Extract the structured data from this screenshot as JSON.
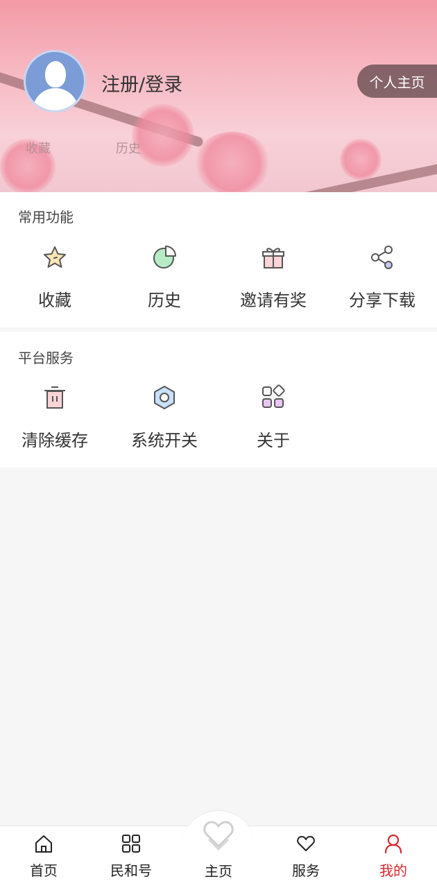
{
  "profile": {
    "login_text": "注册/登录",
    "home_button": "个人主页",
    "stats": [
      {
        "label": "收藏"
      },
      {
        "label": "历史"
      }
    ]
  },
  "common": {
    "title": "常用功能",
    "items": [
      {
        "label": "收藏",
        "icon": "star-icon"
      },
      {
        "label": "历史",
        "icon": "pie-chart-icon"
      },
      {
        "label": "邀请有奖",
        "icon": "gift-icon"
      },
      {
        "label": "分享下载",
        "icon": "share-icon"
      }
    ]
  },
  "platform": {
    "title": "平台服务",
    "items": [
      {
        "label": "清除缓存",
        "icon": "trash-icon"
      },
      {
        "label": "系统开关",
        "icon": "settings-hexagon-icon"
      },
      {
        "label": "关于",
        "icon": "apps-icon"
      }
    ]
  },
  "tabbar": {
    "items": [
      {
        "label": "首页",
        "icon": "home-icon"
      },
      {
        "label": "民和号",
        "icon": "grid-icon"
      },
      {
        "label": "主页",
        "icon": "heart-outline-icon"
      },
      {
        "label": "服务",
        "icon": "heart-icon"
      },
      {
        "label": "我的",
        "icon": "user-icon"
      }
    ],
    "active": "我的",
    "active_color": "#d9262d"
  }
}
